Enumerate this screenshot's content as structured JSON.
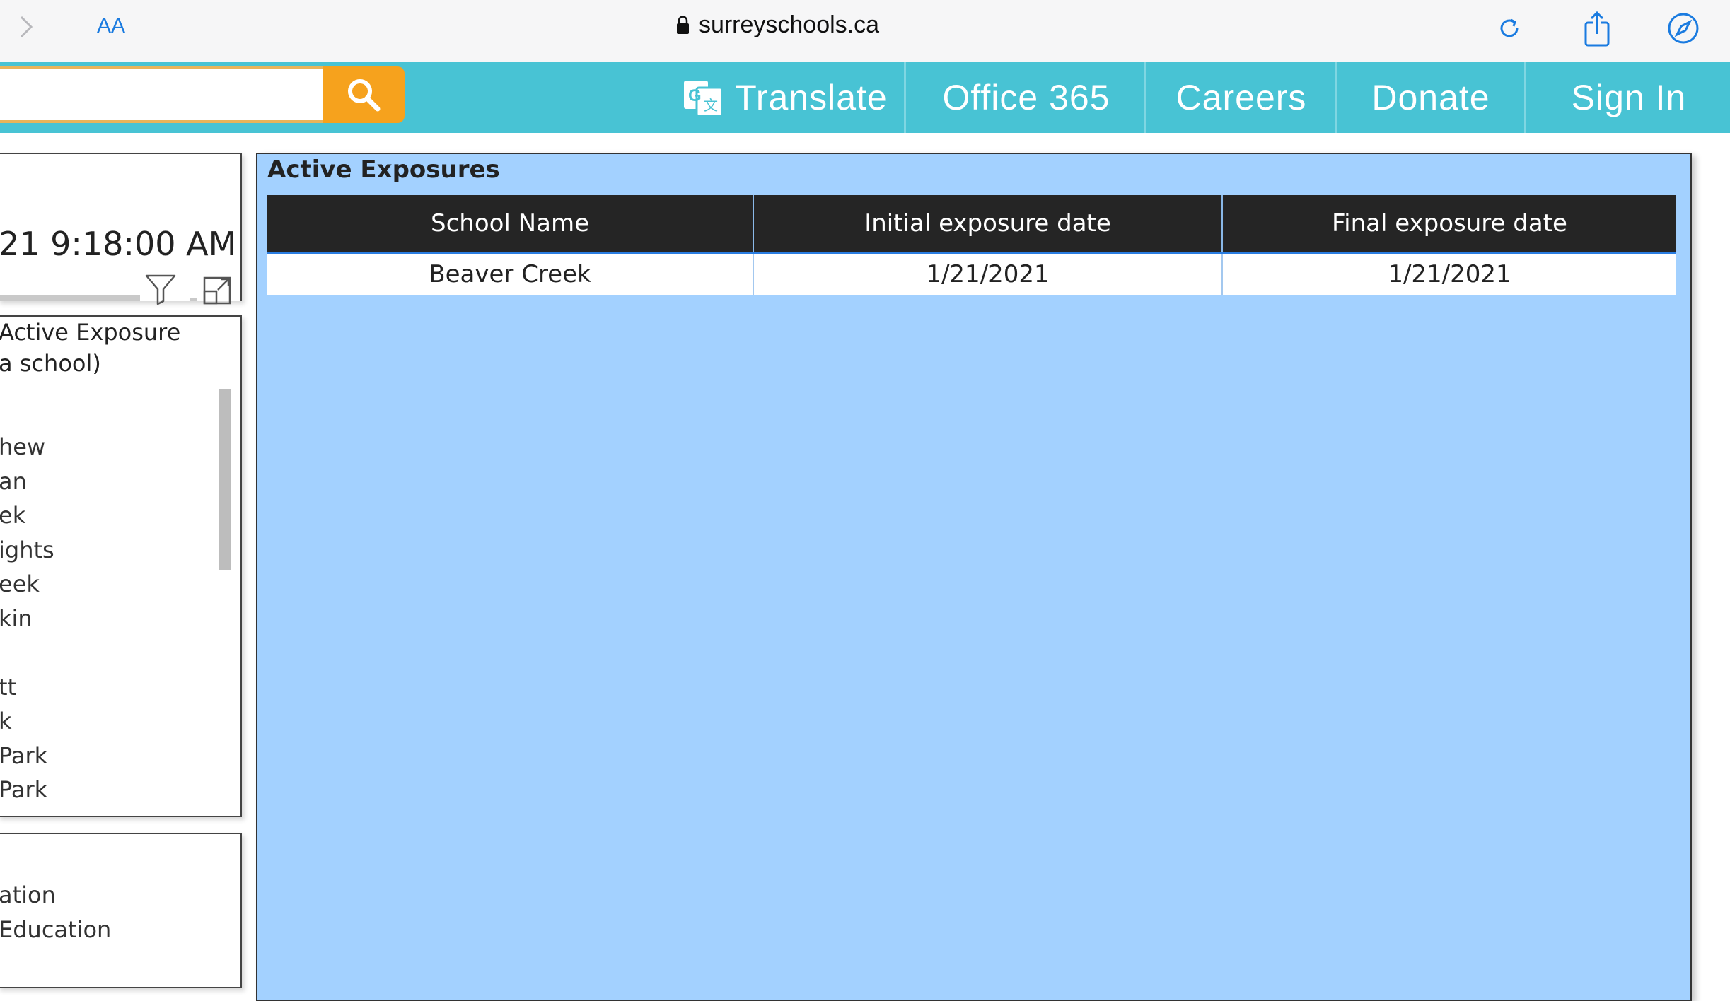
{
  "browser": {
    "aa_label": "AA",
    "url": "surreyschools.ca"
  },
  "site_header": {
    "search_placeholder": "",
    "nav": [
      {
        "label": "Translate"
      },
      {
        "label": "Office 365"
      },
      {
        "label": "Careers"
      },
      {
        "label": "Donate"
      },
      {
        "label": "Sign In"
      }
    ],
    "colors": {
      "header_bg": "#48c3d4",
      "search_button": "#f6a21d"
    }
  },
  "left_panel": {
    "datetime": "21 9:18:00 AM",
    "slicer_header": "Active Exposure\na school)",
    "slicer_items": [
      "hew",
      "an",
      "ek",
      "ights",
      "eek",
      "kin",
      "",
      "tt",
      "k",
      " Park",
      " Park"
    ],
    "bottom_items": [
      "ation",
      " Education"
    ]
  },
  "main": {
    "title": "Active Exposures",
    "table": {
      "columns": [
        "School Name",
        "Initial exposure date",
        "Final exposure date"
      ],
      "rows": [
        [
          "Beaver Creek",
          "1/21/2021",
          "1/21/2021"
        ]
      ]
    },
    "colors": {
      "panel_bg": "#a3d1ff",
      "header_bg": "#252525"
    }
  }
}
